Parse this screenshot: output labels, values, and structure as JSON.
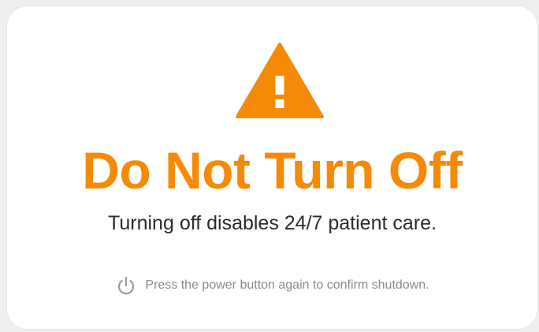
{
  "dialog": {
    "icon": "warning-triangle-icon",
    "title": "Do Not Turn Off",
    "message": "Turning off disables 24/7 patient care.",
    "hint_icon": "power-icon",
    "hint": "Press the power button again to confirm shutdown."
  },
  "colors": {
    "accent": "#f58a07",
    "background": "#ffffff",
    "text": "#2b2b2b",
    "muted": "#8a8a8a"
  }
}
